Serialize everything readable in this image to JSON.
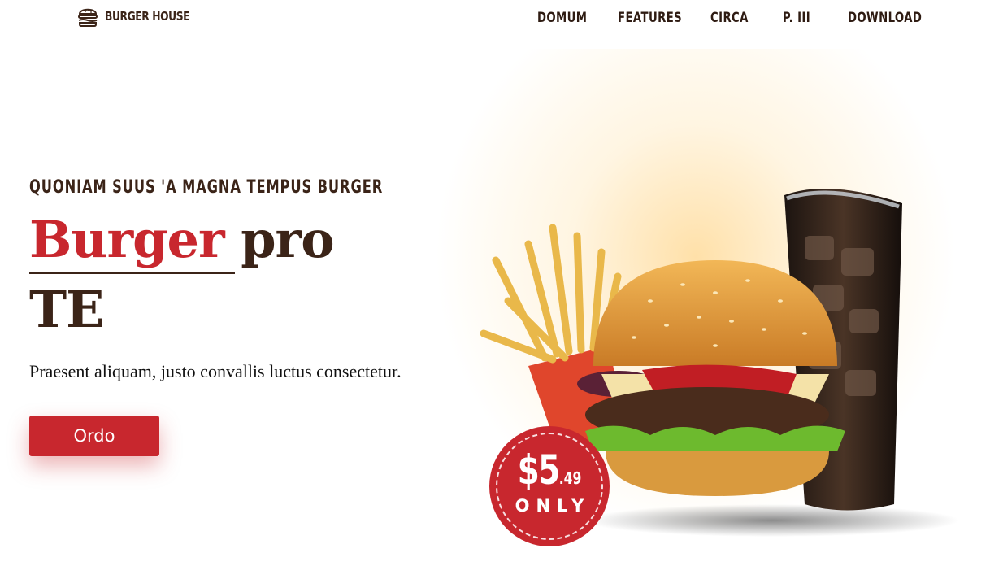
{
  "brand": {
    "name": "BURGER HOUSE",
    "icon": "burger-icon"
  },
  "nav": {
    "items": [
      "DOMUM",
      "FEATURES",
      "CIRCA",
      "P. III",
      "DOWNLOAD"
    ]
  },
  "hero": {
    "eyebrow": "QUONIAM SUUS 'A MAGNA TEMPUS BURGER",
    "headline_highlight": "Burger",
    "headline_rest_1": "pro",
    "headline_rest_2": "TE",
    "subtitle": "Praesent aliquam, justo convallis luctus consectetur.",
    "cta_label": "Ordo"
  },
  "price_badge": {
    "dollars": "$5",
    "cents": ".49",
    "label": "ONLY"
  },
  "colors": {
    "accent": "#c8272e",
    "text_dark": "#3b2418",
    "glow": "#ffd68c"
  },
  "images": {
    "hero": "burger-fries-soda-illustration"
  }
}
